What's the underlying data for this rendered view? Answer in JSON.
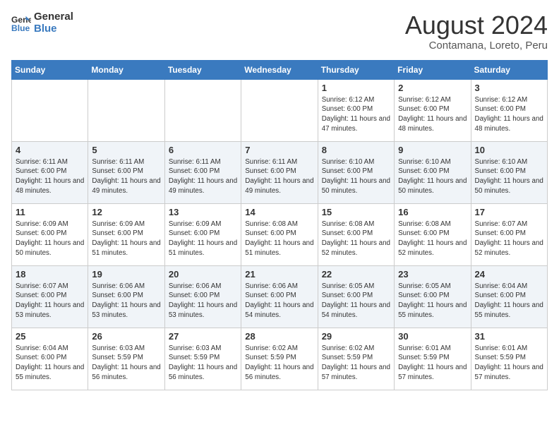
{
  "logo": {
    "line1": "General",
    "line2": "Blue"
  },
  "calendar": {
    "title": "August 2024",
    "subtitle": "Contamana, Loreto, Peru"
  },
  "weekdays": [
    "Sunday",
    "Monday",
    "Tuesday",
    "Wednesday",
    "Thursday",
    "Friday",
    "Saturday"
  ],
  "weeks": [
    [
      {
        "day": "",
        "sunrise": "",
        "sunset": "",
        "daylight": ""
      },
      {
        "day": "",
        "sunrise": "",
        "sunset": "",
        "daylight": ""
      },
      {
        "day": "",
        "sunrise": "",
        "sunset": "",
        "daylight": ""
      },
      {
        "day": "",
        "sunrise": "",
        "sunset": "",
        "daylight": ""
      },
      {
        "day": "1",
        "sunrise": "Sunrise: 6:12 AM",
        "sunset": "Sunset: 6:00 PM",
        "daylight": "Daylight: 11 hours and 47 minutes."
      },
      {
        "day": "2",
        "sunrise": "Sunrise: 6:12 AM",
        "sunset": "Sunset: 6:00 PM",
        "daylight": "Daylight: 11 hours and 48 minutes."
      },
      {
        "day": "3",
        "sunrise": "Sunrise: 6:12 AM",
        "sunset": "Sunset: 6:00 PM",
        "daylight": "Daylight: 11 hours and 48 minutes."
      }
    ],
    [
      {
        "day": "4",
        "sunrise": "Sunrise: 6:11 AM",
        "sunset": "Sunset: 6:00 PM",
        "daylight": "Daylight: 11 hours and 48 minutes."
      },
      {
        "day": "5",
        "sunrise": "Sunrise: 6:11 AM",
        "sunset": "Sunset: 6:00 PM",
        "daylight": "Daylight: 11 hours and 49 minutes."
      },
      {
        "day": "6",
        "sunrise": "Sunrise: 6:11 AM",
        "sunset": "Sunset: 6:00 PM",
        "daylight": "Daylight: 11 hours and 49 minutes."
      },
      {
        "day": "7",
        "sunrise": "Sunrise: 6:11 AM",
        "sunset": "Sunset: 6:00 PM",
        "daylight": "Daylight: 11 hours and 49 minutes."
      },
      {
        "day": "8",
        "sunrise": "Sunrise: 6:10 AM",
        "sunset": "Sunset: 6:00 PM",
        "daylight": "Daylight: 11 hours and 50 minutes."
      },
      {
        "day": "9",
        "sunrise": "Sunrise: 6:10 AM",
        "sunset": "Sunset: 6:00 PM",
        "daylight": "Daylight: 11 hours and 50 minutes."
      },
      {
        "day": "10",
        "sunrise": "Sunrise: 6:10 AM",
        "sunset": "Sunset: 6:00 PM",
        "daylight": "Daylight: 11 hours and 50 minutes."
      }
    ],
    [
      {
        "day": "11",
        "sunrise": "Sunrise: 6:09 AM",
        "sunset": "Sunset: 6:00 PM",
        "daylight": "Daylight: 11 hours and 50 minutes."
      },
      {
        "day": "12",
        "sunrise": "Sunrise: 6:09 AM",
        "sunset": "Sunset: 6:00 PM",
        "daylight": "Daylight: 11 hours and 51 minutes."
      },
      {
        "day": "13",
        "sunrise": "Sunrise: 6:09 AM",
        "sunset": "Sunset: 6:00 PM",
        "daylight": "Daylight: 11 hours and 51 minutes."
      },
      {
        "day": "14",
        "sunrise": "Sunrise: 6:08 AM",
        "sunset": "Sunset: 6:00 PM",
        "daylight": "Daylight: 11 hours and 51 minutes."
      },
      {
        "day": "15",
        "sunrise": "Sunrise: 6:08 AM",
        "sunset": "Sunset: 6:00 PM",
        "daylight": "Daylight: 11 hours and 52 minutes."
      },
      {
        "day": "16",
        "sunrise": "Sunrise: 6:08 AM",
        "sunset": "Sunset: 6:00 PM",
        "daylight": "Daylight: 11 hours and 52 minutes."
      },
      {
        "day": "17",
        "sunrise": "Sunrise: 6:07 AM",
        "sunset": "Sunset: 6:00 PM",
        "daylight": "Daylight: 11 hours and 52 minutes."
      }
    ],
    [
      {
        "day": "18",
        "sunrise": "Sunrise: 6:07 AM",
        "sunset": "Sunset: 6:00 PM",
        "daylight": "Daylight: 11 hours and 53 minutes."
      },
      {
        "day": "19",
        "sunrise": "Sunrise: 6:06 AM",
        "sunset": "Sunset: 6:00 PM",
        "daylight": "Daylight: 11 hours and 53 minutes."
      },
      {
        "day": "20",
        "sunrise": "Sunrise: 6:06 AM",
        "sunset": "Sunset: 6:00 PM",
        "daylight": "Daylight: 11 hours and 53 minutes."
      },
      {
        "day": "21",
        "sunrise": "Sunrise: 6:06 AM",
        "sunset": "Sunset: 6:00 PM",
        "daylight": "Daylight: 11 hours and 54 minutes."
      },
      {
        "day": "22",
        "sunrise": "Sunrise: 6:05 AM",
        "sunset": "Sunset: 6:00 PM",
        "daylight": "Daylight: 11 hours and 54 minutes."
      },
      {
        "day": "23",
        "sunrise": "Sunrise: 6:05 AM",
        "sunset": "Sunset: 6:00 PM",
        "daylight": "Daylight: 11 hours and 55 minutes."
      },
      {
        "day": "24",
        "sunrise": "Sunrise: 6:04 AM",
        "sunset": "Sunset: 6:00 PM",
        "daylight": "Daylight: 11 hours and 55 minutes."
      }
    ],
    [
      {
        "day": "25",
        "sunrise": "Sunrise: 6:04 AM",
        "sunset": "Sunset: 6:00 PM",
        "daylight": "Daylight: 11 hours and 55 minutes."
      },
      {
        "day": "26",
        "sunrise": "Sunrise: 6:03 AM",
        "sunset": "Sunset: 5:59 PM",
        "daylight": "Daylight: 11 hours and 56 minutes."
      },
      {
        "day": "27",
        "sunrise": "Sunrise: 6:03 AM",
        "sunset": "Sunset: 5:59 PM",
        "daylight": "Daylight: 11 hours and 56 minutes."
      },
      {
        "day": "28",
        "sunrise": "Sunrise: 6:02 AM",
        "sunset": "Sunset: 5:59 PM",
        "daylight": "Daylight: 11 hours and 56 minutes."
      },
      {
        "day": "29",
        "sunrise": "Sunrise: 6:02 AM",
        "sunset": "Sunset: 5:59 PM",
        "daylight": "Daylight: 11 hours and 57 minutes."
      },
      {
        "day": "30",
        "sunrise": "Sunrise: 6:01 AM",
        "sunset": "Sunset: 5:59 PM",
        "daylight": "Daylight: 11 hours and 57 minutes."
      },
      {
        "day": "31",
        "sunrise": "Sunrise: 6:01 AM",
        "sunset": "Sunset: 5:59 PM",
        "daylight": "Daylight: 11 hours and 57 minutes."
      }
    ]
  ]
}
